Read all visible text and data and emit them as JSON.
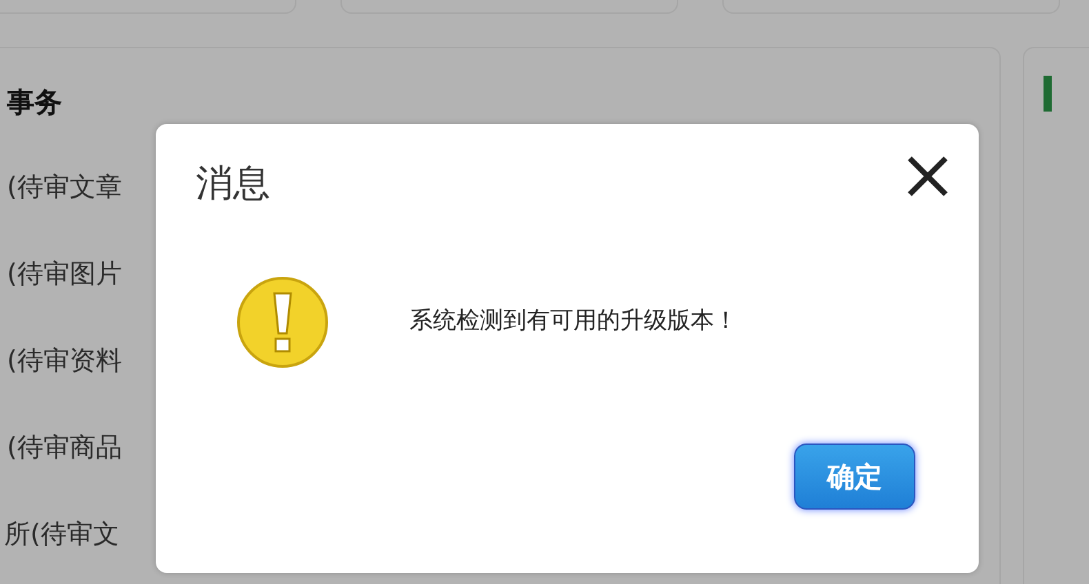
{
  "background": {
    "heading": "事务",
    "items": [
      "(待审文章",
      "(待审图片",
      "(待审资料",
      "(待审商品",
      "所(待审文"
    ]
  },
  "dialog": {
    "title": "消息",
    "message": "系统检测到有可用的升级版本！",
    "buttons": [
      {
        "label": "确定"
      }
    ]
  }
}
